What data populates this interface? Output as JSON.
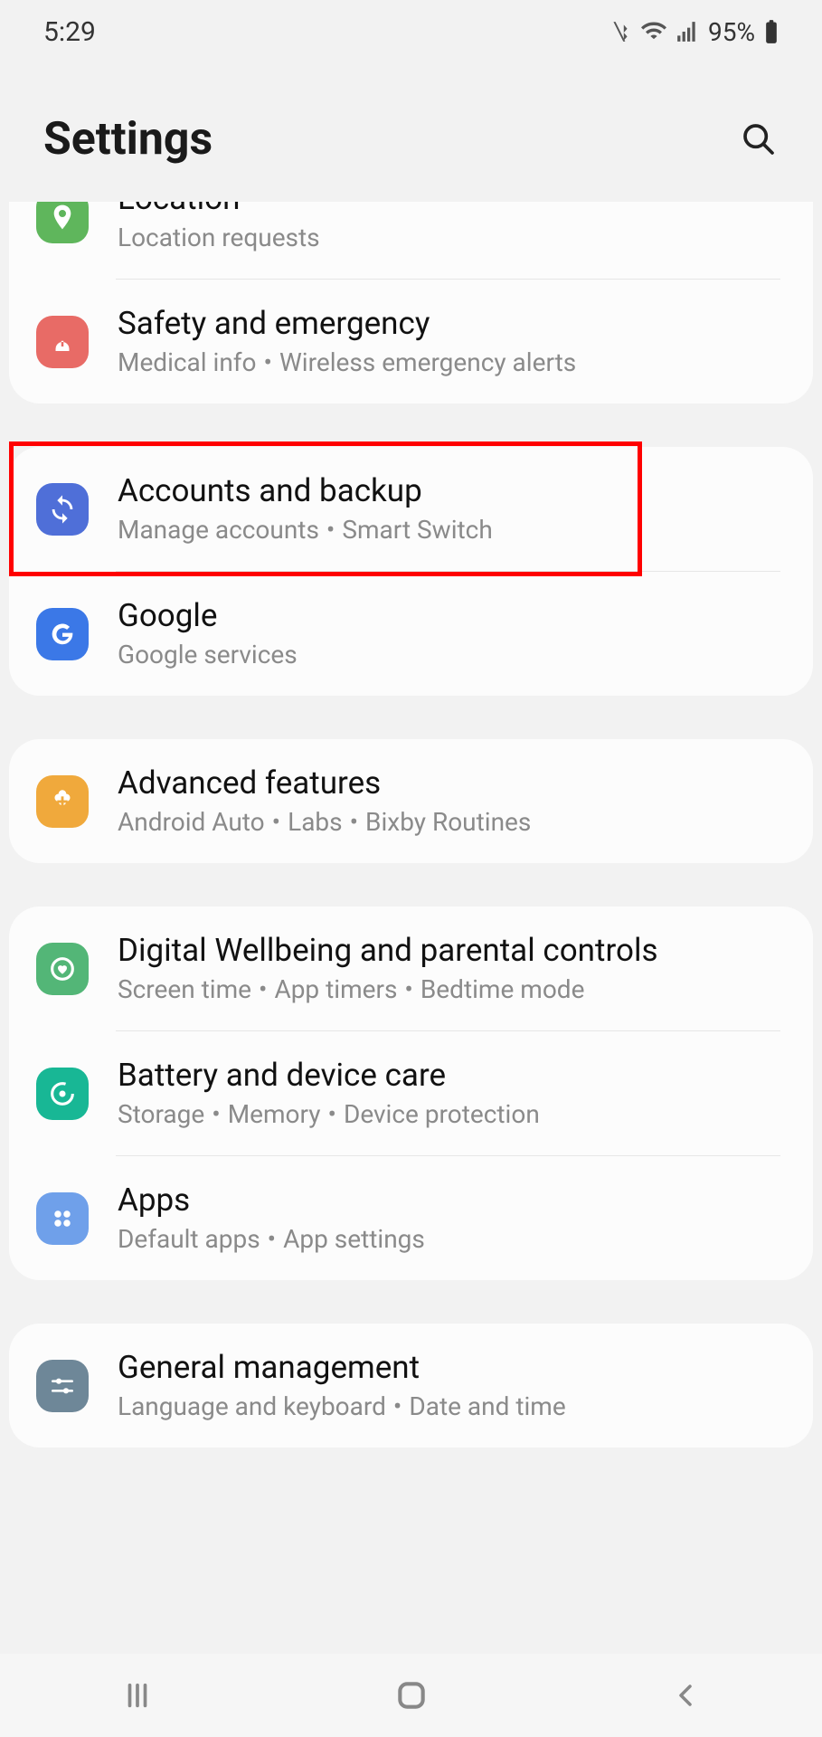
{
  "status": {
    "time": "5:29",
    "battery_pct": "95%"
  },
  "header": {
    "title": "Settings"
  },
  "groups": [
    {
      "clip_top": true,
      "items": [
        {
          "id": "location",
          "title": "Location",
          "subtitle_parts": [
            "Location requests"
          ],
          "icon": "location-pin-icon",
          "icon_bg": "#5fb65c"
        },
        {
          "id": "safety",
          "title": "Safety and emergency",
          "subtitle_parts": [
            "Medical info",
            "Wireless emergency alerts"
          ],
          "icon": "siren-icon",
          "icon_bg": "#e86b66"
        }
      ]
    },
    {
      "items": [
        {
          "id": "accounts",
          "title": "Accounts and backup",
          "subtitle_parts": [
            "Manage accounts",
            "Smart Switch"
          ],
          "icon": "sync-icon",
          "icon_bg": "#4f6fd8",
          "highlight": true
        },
        {
          "id": "google",
          "title": "Google",
          "subtitle_parts": [
            "Google services"
          ],
          "icon": "google-g-icon",
          "icon_bg": "#3b78e7"
        }
      ]
    },
    {
      "items": [
        {
          "id": "advanced",
          "title": "Advanced features",
          "subtitle_parts": [
            "Android Auto",
            "Labs",
            "Bixby Routines"
          ],
          "icon": "plus-flower-icon",
          "icon_bg": "#f0a93c"
        }
      ]
    },
    {
      "items": [
        {
          "id": "wellbeing",
          "title": "Digital Wellbeing and parental controls",
          "subtitle_parts": [
            "Screen time",
            "App timers",
            "Bedtime mode"
          ],
          "icon": "heart-circle-icon",
          "icon_bg": "#53b677"
        },
        {
          "id": "battery",
          "title": "Battery and device care",
          "subtitle_parts": [
            "Storage",
            "Memory",
            "Device protection"
          ],
          "icon": "refresh-circle-icon",
          "icon_bg": "#18b795"
        },
        {
          "id": "apps",
          "title": "Apps",
          "subtitle_parts": [
            "Default apps",
            "App settings"
          ],
          "icon": "four-dots-icon",
          "icon_bg": "#6fa0ea"
        }
      ]
    },
    {
      "clip_bottom": true,
      "items": [
        {
          "id": "general",
          "title": "General management",
          "subtitle_parts": [
            "Language and keyboard",
            "Date and time"
          ],
          "icon": "sliders-icon",
          "icon_bg": "#6e8798"
        }
      ]
    }
  ]
}
